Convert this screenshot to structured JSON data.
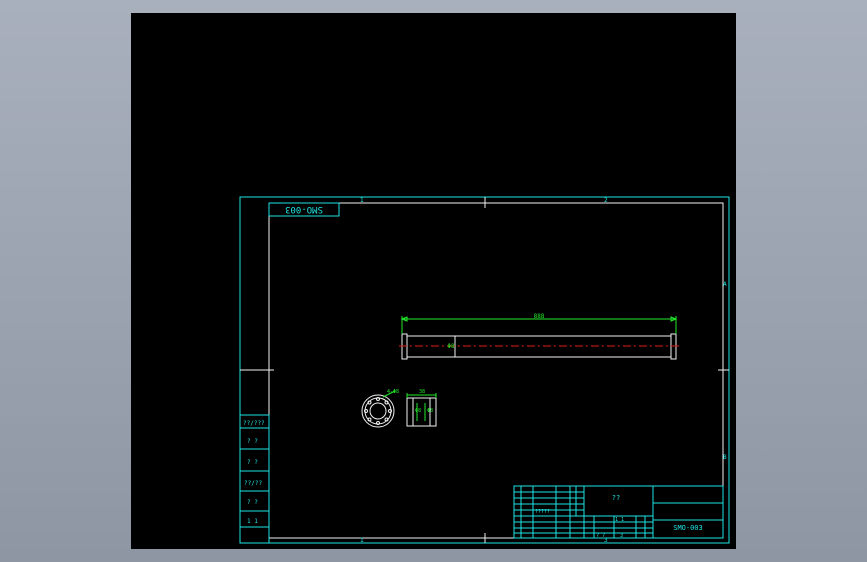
{
  "drawing": {
    "rotated_code": "SMO-003",
    "title_block_code": "SMO-003",
    "title_block_name": "??",
    "dims": {
      "length": "888",
      "diameter": "Φ8",
      "holes": "4-Φ8",
      "side_width": "38",
      "side_d1": "Φ8",
      "side_d2": "Φ8"
    },
    "zones_top": [
      "1",
      "2"
    ],
    "zones_bottom": [
      "1",
      "3"
    ],
    "zones_right": [
      "A",
      "B"
    ],
    "side_table": [
      "??/???",
      "? ?",
      "? ?",
      "??/??",
      "? ?",
      "1 1"
    ],
    "title_cells": {
      "scale_label": "?????",
      "sub": "1 1",
      "bottom_a": "? ?",
      "bottom_b": "3"
    }
  },
  "colors": {
    "frame": "#1ee3e3",
    "geometry": "#f2f2f2",
    "dimension": "#22e82a",
    "centerline": "#e01818"
  }
}
